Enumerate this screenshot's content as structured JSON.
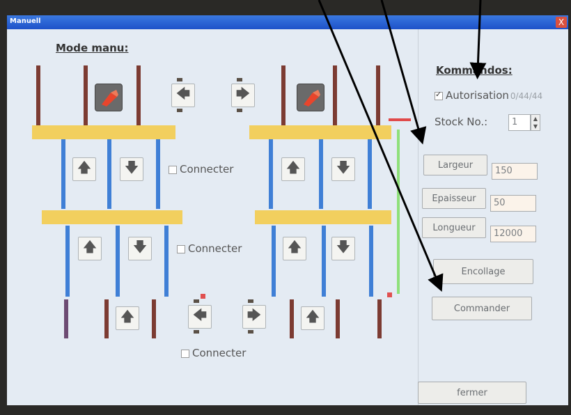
{
  "window": {
    "title": "Manuell",
    "close_glyph": "X"
  },
  "left": {
    "header": "Mode manu:",
    "connecter_1": "Connecter",
    "connecter_2": "Connecter",
    "connecter_3": "Connecter",
    "arrow_up": "🡅",
    "arrow_down": "🡇",
    "arrow_left": "🡄",
    "arrow_right": "🡆"
  },
  "right": {
    "header": "Kommandos:",
    "autorisation_label": "Autorisation",
    "autorisation_count": "0/44/44",
    "autorisation_checked": true,
    "stock_label": "Stock No.:",
    "stock_value": "1",
    "largeur_label": "Largeur",
    "largeur_value": "150",
    "epaisseur_label": "Epaisseur",
    "epaisseur_value": "50",
    "longueur_label": "Longueur",
    "longueur_value": "12000",
    "encollage_label": "Encollage",
    "commander_label": "Commander",
    "fermer_label": "fermer"
  },
  "colors": {
    "yellow_bar": "#f2cf5e",
    "blue_bar": "#3f7fd6",
    "brown_bar": "#7c3b32",
    "green_bar": "#8fe07a",
    "red_indicator": "#e04a4a",
    "purple_bar": "#6d4b73"
  },
  "icons": [
    "up-arrow-icon",
    "down-arrow-icon",
    "left-arrow-icon",
    "right-arrow-icon",
    "valve-icon",
    "checkbox-icon",
    "spin-up-icon",
    "spin-down-icon",
    "close-icon"
  ]
}
